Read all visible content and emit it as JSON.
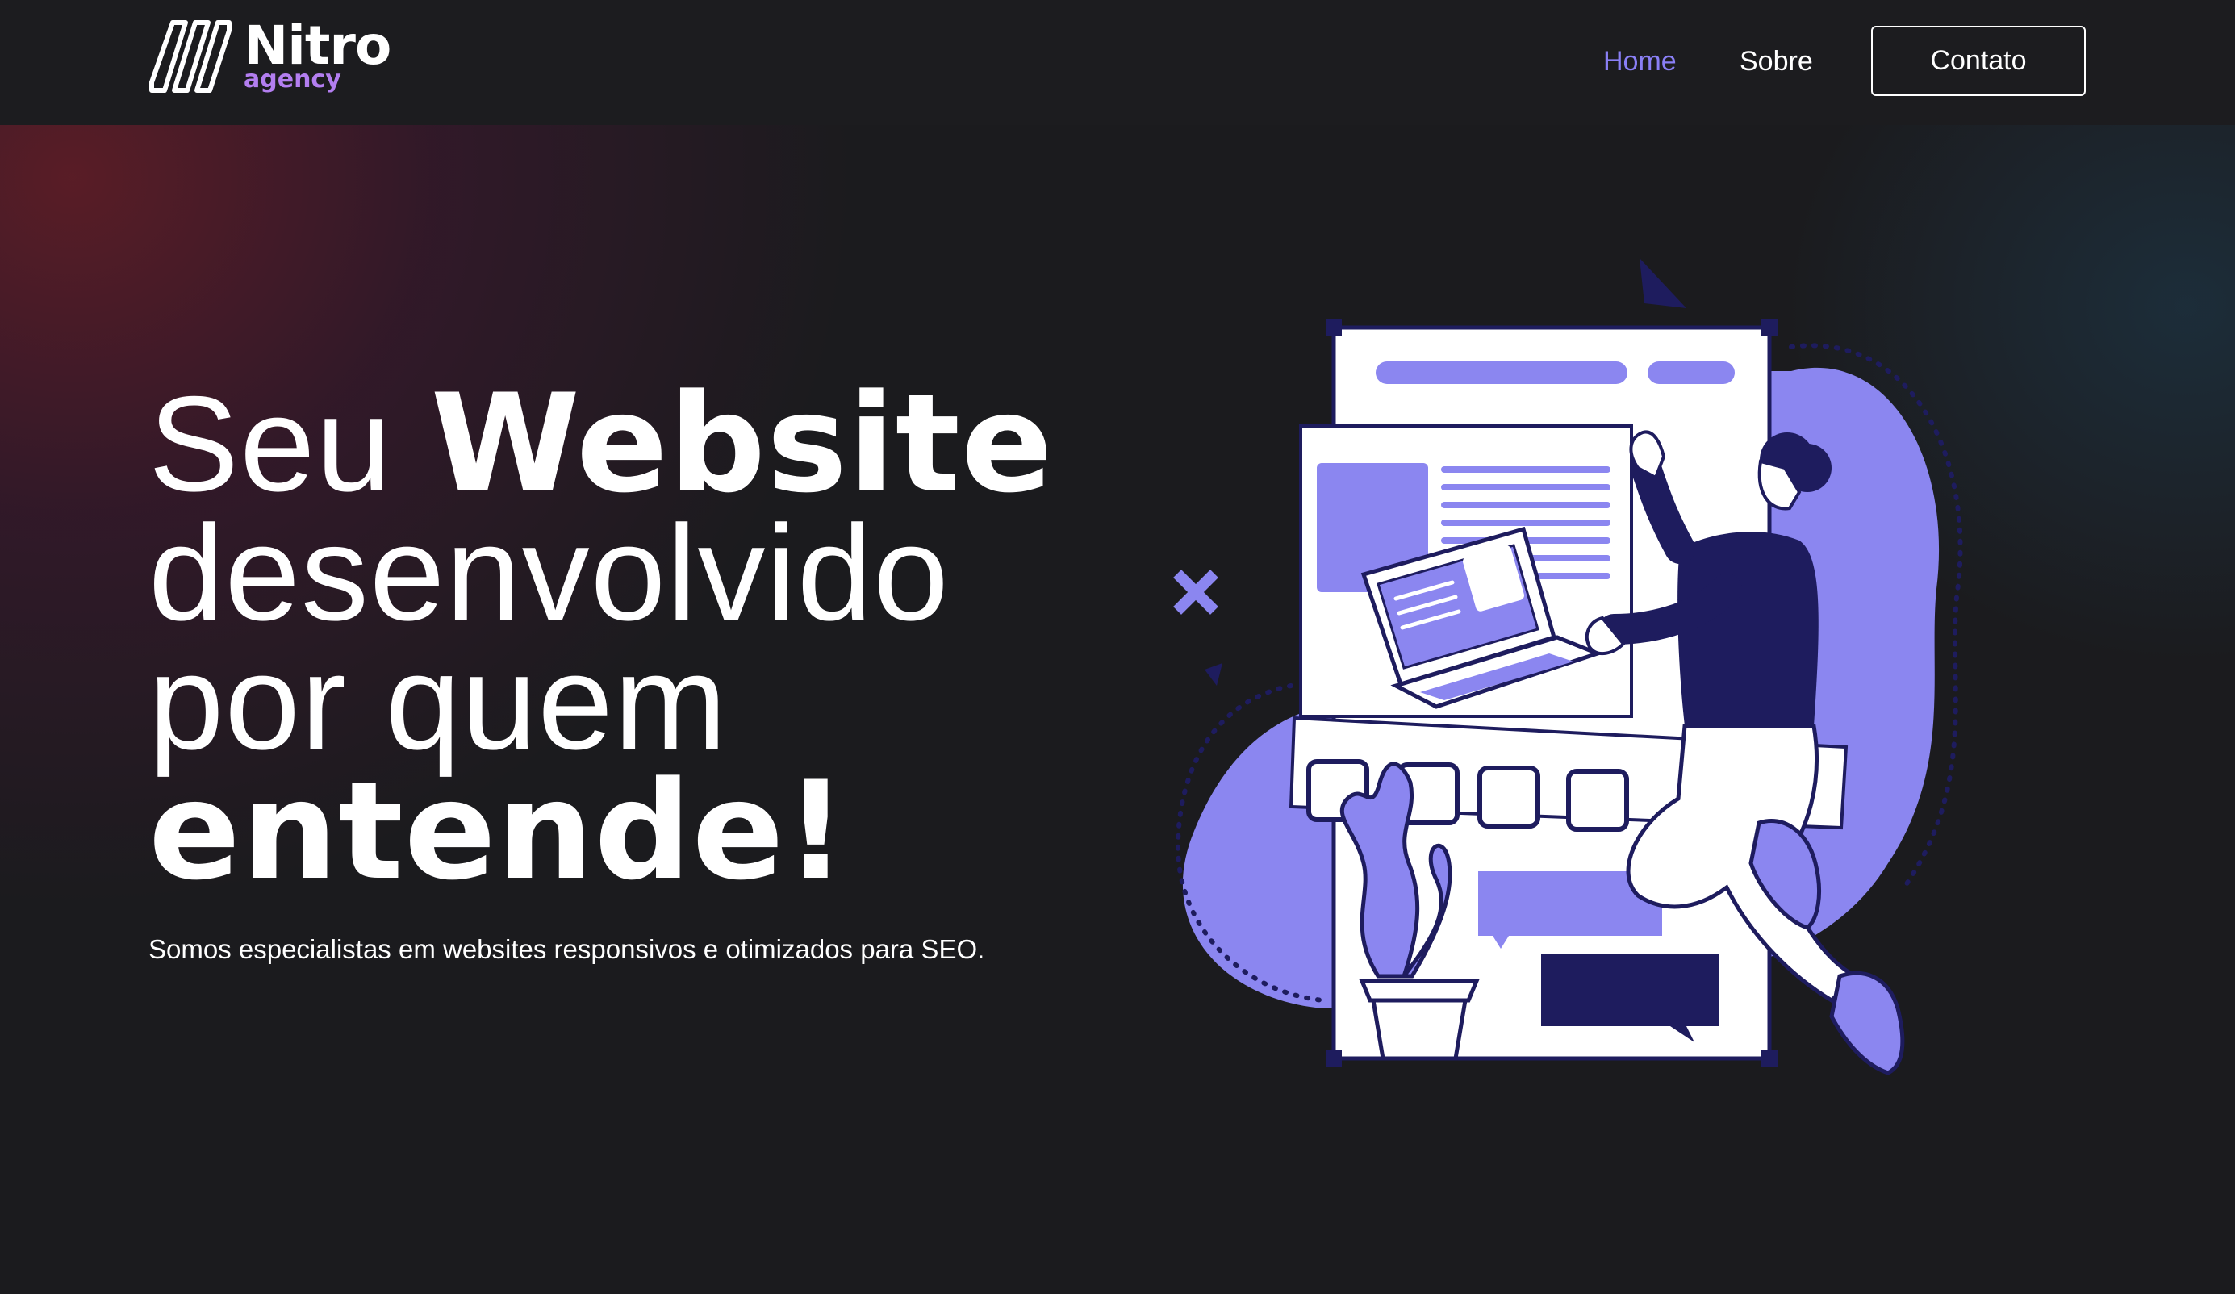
{
  "brand": {
    "name": "Nitro",
    "subtitle": "agency",
    "accent_color": "#b37ef0",
    "logo_icon": "slanted-stripes-logo-icon"
  },
  "nav": {
    "links": [
      {
        "label": "Home",
        "active": true,
        "color": "#8a7ff5"
      },
      {
        "label": "Sobre",
        "active": false,
        "color": "#ffffff"
      }
    ],
    "contact_label": "Contato"
  },
  "hero": {
    "title_lines": [
      {
        "light": "Seu ",
        "bold": "Website"
      },
      {
        "light": "desenvolvido",
        "bold": ""
      },
      {
        "light": "por quem",
        "bold": ""
      },
      {
        "light": "",
        "bold": "entende!"
      }
    ],
    "subtitle": "Somos especialistas em websites responsivos e otimizados para SEO."
  },
  "illustration": {
    "description_icon": "web-developer-illustration-icon",
    "colors": {
      "primary": "#8b86f0",
      "dark": "#1e1c5e",
      "light": "#ffffff"
    }
  },
  "theme": {
    "background": "#1b1b1e",
    "navbar_background": "#1c1c1f"
  }
}
